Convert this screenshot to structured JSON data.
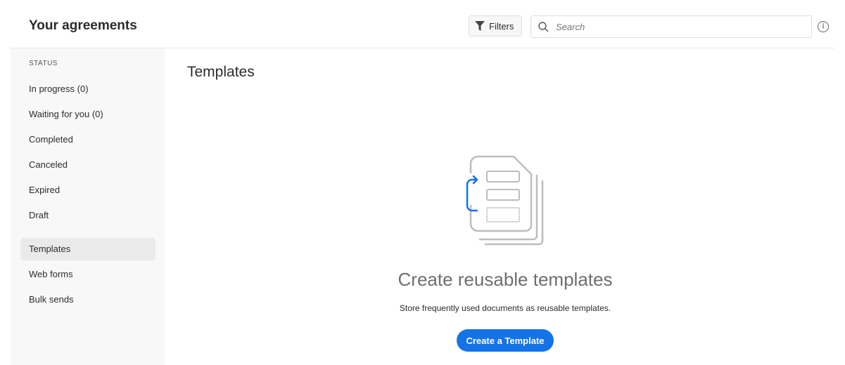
{
  "header": {
    "title": "Your agreements",
    "filters_label": "Filters",
    "search_placeholder": "Search"
  },
  "sidebar": {
    "status_label": "STATUS",
    "items": [
      {
        "label": "In progress (0)"
      },
      {
        "label": "Waiting for you (0)"
      },
      {
        "label": "Completed"
      },
      {
        "label": "Canceled"
      },
      {
        "label": "Expired"
      },
      {
        "label": "Draft"
      },
      {
        "label": "Templates"
      },
      {
        "label": "Web forms"
      },
      {
        "label": "Bulk sends"
      }
    ],
    "selected": "Templates"
  },
  "main": {
    "title": "Templates",
    "empty_heading": "Create reusable templates",
    "empty_text": "Store frequently used documents as reusable templates.",
    "create_button": "Create a Template"
  },
  "colors": {
    "accent": "#1473e6"
  }
}
